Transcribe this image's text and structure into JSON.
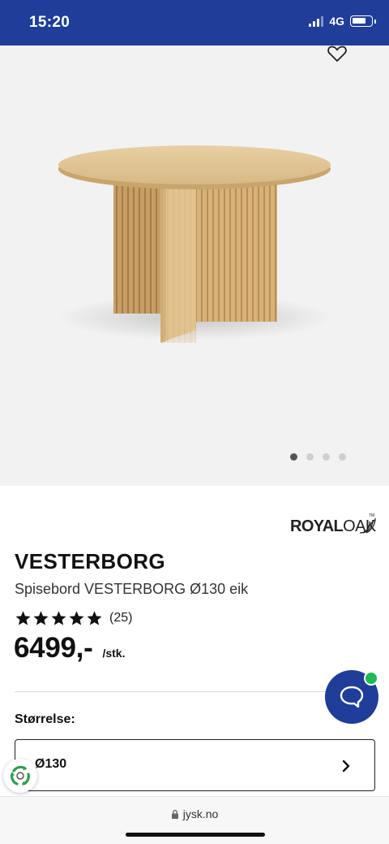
{
  "status_bar": {
    "time": "15:20",
    "network": "4G",
    "battery_level": 0.7,
    "signal_bars_active": 3,
    "background_color": "#1f3d99"
  },
  "gallery": {
    "favorite_icon": "heart-outline-icon",
    "image_count": 4,
    "active_image_index": 0,
    "background_color": "#f2f2f2"
  },
  "brand": {
    "logo_text_bold": "ROYAL",
    "logo_text_light": "OAK",
    "logo_mark": "TM"
  },
  "product": {
    "name": "VESTERBORG",
    "subtitle": "Spisebord VESTERBORG Ø130 eik",
    "rating": 5,
    "rating_max": 5,
    "review_count": "(25)",
    "price": "6499,-",
    "unit": "/stk."
  },
  "size": {
    "label": "Størrelse:",
    "selected": "Ø130",
    "chevron_icon": "chevron-right-icon"
  },
  "chat": {
    "icon": "chat-bubble-icon",
    "online_indicator_color": "#1db954",
    "button_color": "#1f3d99"
  },
  "eco_badge": {
    "icon": "recycle-icon"
  },
  "browser": {
    "url": "jysk.no",
    "lock_icon": "lock-icon"
  }
}
